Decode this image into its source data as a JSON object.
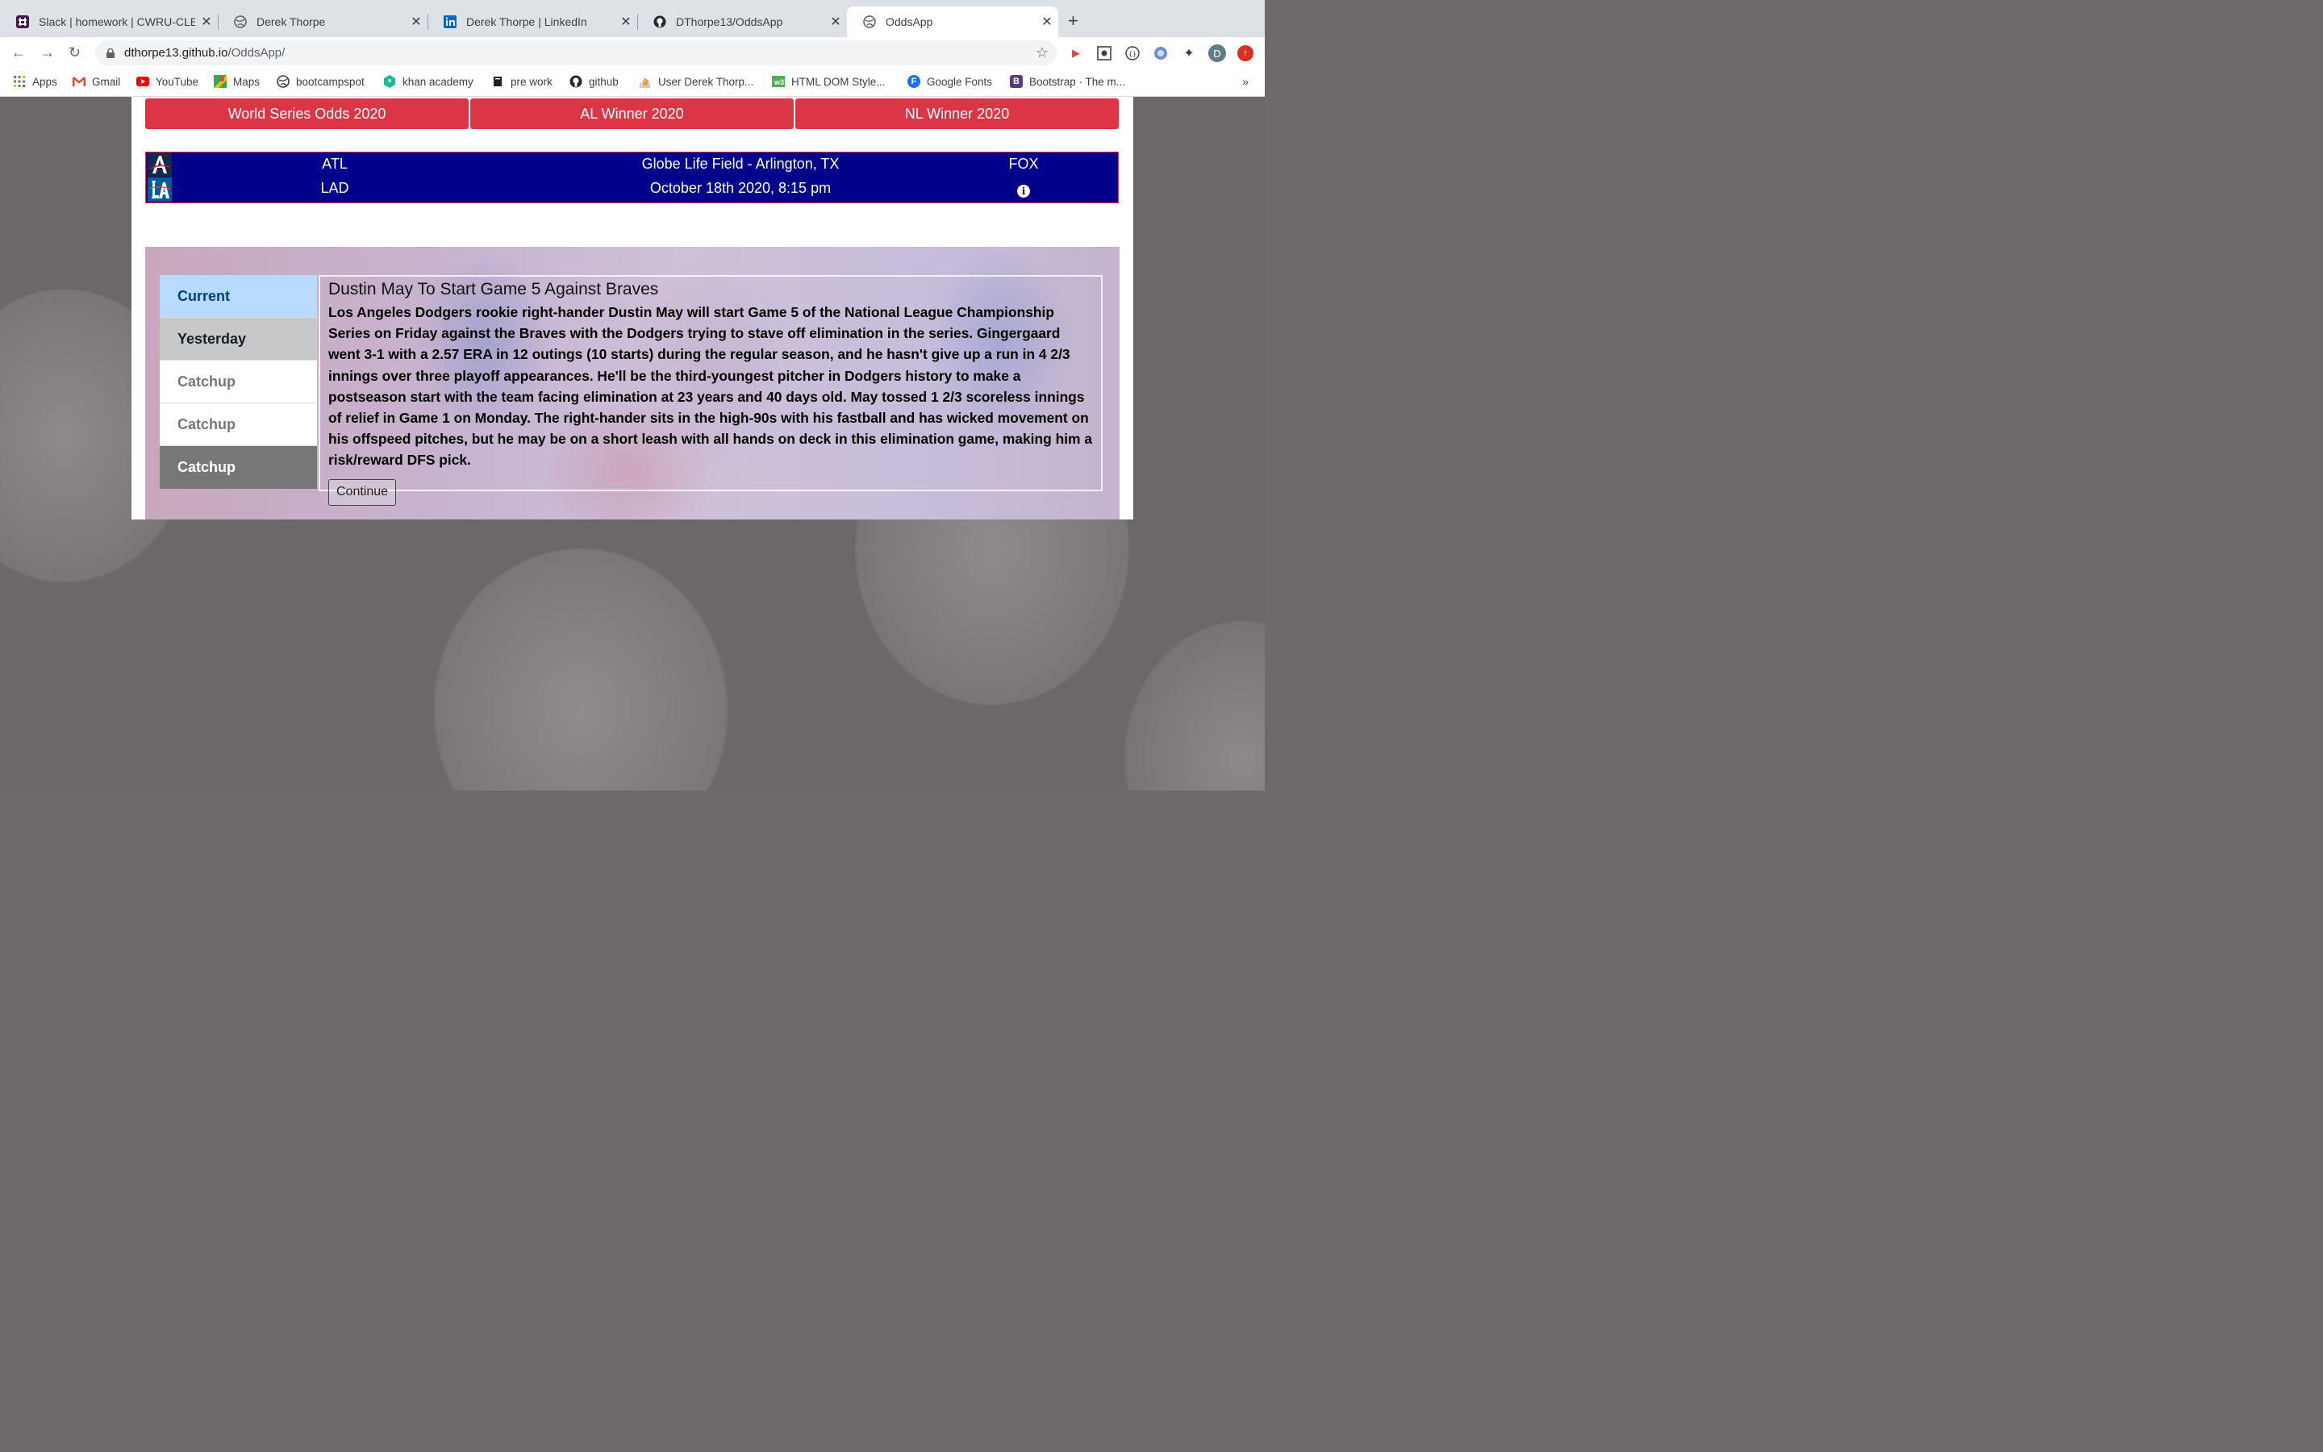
{
  "browser": {
    "tabs": [
      {
        "title": "Slack | homework | CWRU-CLE",
        "icon": "slack-icon",
        "active": false
      },
      {
        "title": "Derek Thorpe",
        "icon": "globe-icon",
        "active": false
      },
      {
        "title": "Derek Thorpe | LinkedIn",
        "icon": "linkedin-icon",
        "active": false
      },
      {
        "title": "DThorpe13/OddsApp",
        "icon": "github-icon",
        "active": false
      },
      {
        "title": "OddsApp",
        "icon": "globe-icon",
        "active": true
      }
    ],
    "url_host": "dthorpe13.github.io",
    "url_path": "/OddsApp/",
    "profile_initial": "D",
    "bookmarks": [
      {
        "label": "Apps",
        "icon": "apps-grid-icon"
      },
      {
        "label": "Gmail",
        "icon": "gmail-icon"
      },
      {
        "label": "YouTube",
        "icon": "youtube-icon"
      },
      {
        "label": "Maps",
        "icon": "maps-icon"
      },
      {
        "label": "bootcampspot",
        "icon": "globe-icon"
      },
      {
        "label": "khan academy",
        "icon": "khan-icon"
      },
      {
        "label": "pre work",
        "icon": "book-icon"
      },
      {
        "label": "github",
        "icon": "github-icon"
      },
      {
        "label": "User Derek Thorp...",
        "icon": "stackoverflow-icon"
      },
      {
        "label": "HTML DOM Style...",
        "icon": "w3schools-icon"
      },
      {
        "label": "Google Fonts",
        "icon": "google-fonts-icon"
      },
      {
        "label": "Bootstrap · The m...",
        "icon": "bootstrap-icon"
      }
    ],
    "more_label": "»"
  },
  "nav_buttons": {
    "world_series": "World Series Odds 2020",
    "al_winner": "AL Winner 2020",
    "nl_winner": "NL Winner 2020"
  },
  "game": {
    "team_away": "ATL",
    "team_home": "LAD",
    "venue": "Globe Life Field - Arlington, TX",
    "datetime": "October 18th 2020, 8:15 pm",
    "network": "FOX",
    "info_symbol": "i"
  },
  "news_tabs": [
    {
      "label": "Current"
    },
    {
      "label": "Yesterday"
    },
    {
      "label": "Catchup"
    },
    {
      "label": "Catchup"
    },
    {
      "label": "Catchup"
    }
  ],
  "article": {
    "headline": "Dustin May To Start Game 5 Against Braves",
    "body": "Los Angeles Dodgers rookie right-hander Dustin May will start Game 5 of the National League Championship Series on Friday against the Braves with the Dodgers trying to stave off elimination in the series. Gingergaard went 3-1 with a 2.57 ERA in 12 outings (10 starts) during the regular season, and he hasn't give up a run in 4 2/3 innings over three playoff appearances. He'll be the third-youngest pitcher in Dodgers history to make a postseason start with the team facing elimination at 23 years and 40 days old. May tossed 1 2/3 scoreless innings of relief in Game 1 on Monday. The right-hander sits in the high-90s with his fastball and has wicked movement on his offspeed pitches, but he may be on a short leash with all hands on deck in this elimination game, making him a risk/reward DFS pick.",
    "continue_label": "Continue"
  },
  "colors": {
    "button_red": "#dc3545",
    "game_bar_blue": "#00008b",
    "tab_current": "#b8daff"
  }
}
